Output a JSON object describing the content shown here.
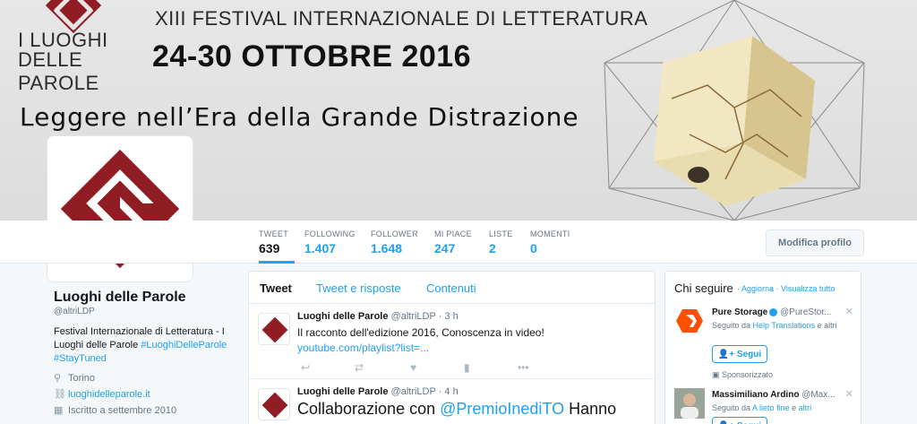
{
  "banner": {
    "logo_line1": "I LUOGHI",
    "logo_line2": "DELLE PAROLE",
    "subtitle": "XIII FESTIVAL INTERNAZIONALE DI LETTERATURA",
    "dates": "24-30 OTTOBRE 2016",
    "tagline": "Leggere nell’Era della Grande Distrazione"
  },
  "nav": {
    "stats": [
      {
        "label": "TWEET",
        "value": "639"
      },
      {
        "label": "FOLLOWING",
        "value": "1.407"
      },
      {
        "label": "FOLLOWER",
        "value": "1.648"
      },
      {
        "label": "MI PIACE",
        "value": "247"
      },
      {
        "label": "LISTE",
        "value": "2"
      },
      {
        "label": "MOMENTI",
        "value": "0"
      }
    ],
    "edit_profile": "Modifica profilo"
  },
  "profile": {
    "name": "Luoghi delle Parole",
    "handle": "@altriLDP",
    "bio_text": "Festival Internazionale di Letteratura - I Luoghi delle Parole ",
    "bio_hashtag1": "#LuoghiDelleParole",
    "bio_hashtag2": "#StayTuned",
    "location": "Torino",
    "website": "luoghidelleparole.it",
    "joined": "Iscritto a settembre 2010"
  },
  "timeline": {
    "tabs": [
      "Tweet",
      "Tweet e risposte",
      "Contenuti"
    ],
    "tweets": [
      {
        "name": "Luoghi delle Parole",
        "handle": "@altriLDP · 3 h",
        "text": "Il racconto dell'edizione 2016, Conoscenza in video!",
        "link": "youtube.com/playlist?list=..."
      },
      {
        "name": "Luoghi delle Parole",
        "handle": "@altriLDP · 4 h",
        "text": "Collaborazione con ",
        "mention": "@PremioInediTO",
        "text2": " Hanno"
      }
    ]
  },
  "who_to_follow": {
    "title": "Chi seguire",
    "links": "· Aggiorna · Visualizza tutto",
    "follow_label": "Segui",
    "suggestions": [
      {
        "name": "Pure Storage",
        "handle": "@PureStor...",
        "context_prefix": "Seguito da ",
        "context_link": "Help Translations",
        "context_suffix": " e altri",
        "sponsored": "Sponsorizzato"
      },
      {
        "name": "Massimiliano Ardino",
        "handle": "@Max...",
        "context_prefix": "Seguito da ",
        "context_link": "A lieto fine",
        "context_mid": " e ",
        "context_link2": "altri"
      }
    ]
  }
}
